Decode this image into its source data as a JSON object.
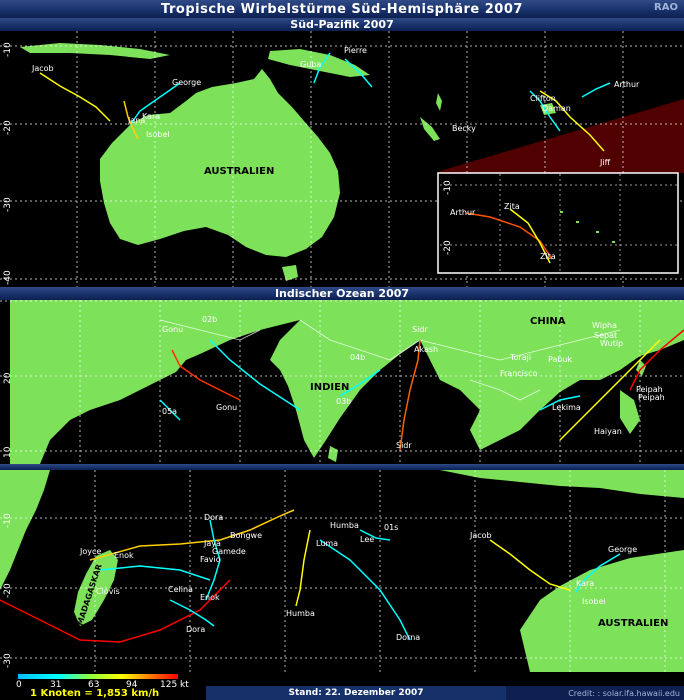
{
  "title": "Tropische Wirbelstürme Süd-Hemisphäre 2007",
  "logo": "RAO",
  "panels": {
    "south_pacific": {
      "title": "Süd-Pazifik 2007",
      "lat_ticks": [
        "-10",
        "-20",
        "-30",
        "-40"
      ],
      "region_label": "AUSTRALIEN",
      "storms": [
        "Jacob",
        "George",
        "Jana",
        "Kara",
        "Isobel",
        "Guba",
        "Pierre",
        "Clifton",
        "Daman",
        "Arthur",
        "Becky",
        "Jiff"
      ],
      "inset": {
        "lat_ticks": [
          "-10",
          "-20"
        ],
        "storms": [
          "Arthur",
          "Zita",
          "Zita"
        ]
      }
    },
    "indian_ocean": {
      "title": "Indischer Ozean 2007",
      "lat_ticks": [
        "20",
        "10"
      ],
      "region_labels": [
        "INDIEN",
        "CHINA"
      ],
      "storms": [
        "Gonu",
        "02b",
        "Sidr",
        "Akash",
        "04b",
        "03b",
        "05a",
        "Gonu",
        "Sidr",
        "Toraji",
        "Pabuk",
        "Francisco",
        "Wipha",
        "Sepat",
        "Wutip",
        "Lekima",
        "Peipah",
        "Peipah",
        "Haiyan"
      ]
    },
    "south_indian": {
      "lat_ticks": [
        "-10",
        "-20",
        "-30"
      ],
      "region_labels": [
        "MADAGASKAR",
        "AUSTRALIEN"
      ],
      "storms": [
        "Dora",
        "Bongwe",
        "Jaya",
        "Gamede",
        "Favio",
        "Joyce",
        "Enok",
        "Clovis",
        "Celina",
        "Enok",
        "Dora",
        "Humba",
        "Lee",
        "01s",
        "Luma",
        "Humba",
        "Dorna",
        "Jacob",
        "George",
        "Kara",
        "Isobel"
      ]
    }
  },
  "legend": {
    "ticks": [
      "0",
      "31",
      "63",
      "94",
      "125 kt"
    ],
    "conversion": "1 Knoten = 1,853 km/h"
  },
  "stand": "Stand: 22. Dezember 2007",
  "credit": "Credit: : solar.ifa.hawaii.edu",
  "colors": {
    "land": "#7de25a",
    "ocean": "#000000",
    "header": "#17306a",
    "grid": "#ffffff"
  }
}
